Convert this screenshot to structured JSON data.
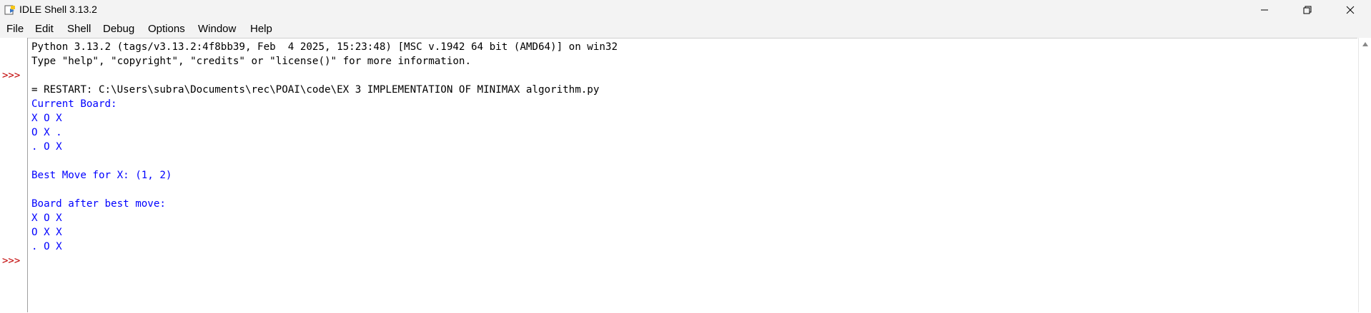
{
  "window": {
    "title": "IDLE Shell 3.13.2"
  },
  "menu": [
    "File",
    "Edit",
    "Shell",
    "Debug",
    "Options",
    "Window",
    "Help"
  ],
  "prompts": [
    ">>>",
    ">>>"
  ],
  "shell_lines": [
    "Python 3.13.2 (tags/v3.13.2:4f8bb39, Feb  4 2025, 15:23:48) [MSC v.1942 64 bit (AMD64)] on win32",
    "Type \"help\", \"copyright\", \"credits\" or \"license()\" for more information.",
    "",
    "= RESTART: C:\\Users\\subra\\Documents\\rec\\POAI\\code\\EX 3 IMPLEMENTATION OF MINIMAX algorithm.py",
    "Current Board:",
    "X O X",
    "O X .",
    ". O X",
    "",
    "Best Move for X: (1, 2)",
    "",
    "Board after best move:",
    "X O X",
    "O X X",
    ". O X"
  ],
  "colors": {
    "output": "#0000ff",
    "prompt": "#c00000",
    "text": "#000000"
  },
  "icons": {
    "minimize": "minimize-icon",
    "restore": "restore-icon",
    "close": "close-icon",
    "app": "python-idle-icon"
  }
}
